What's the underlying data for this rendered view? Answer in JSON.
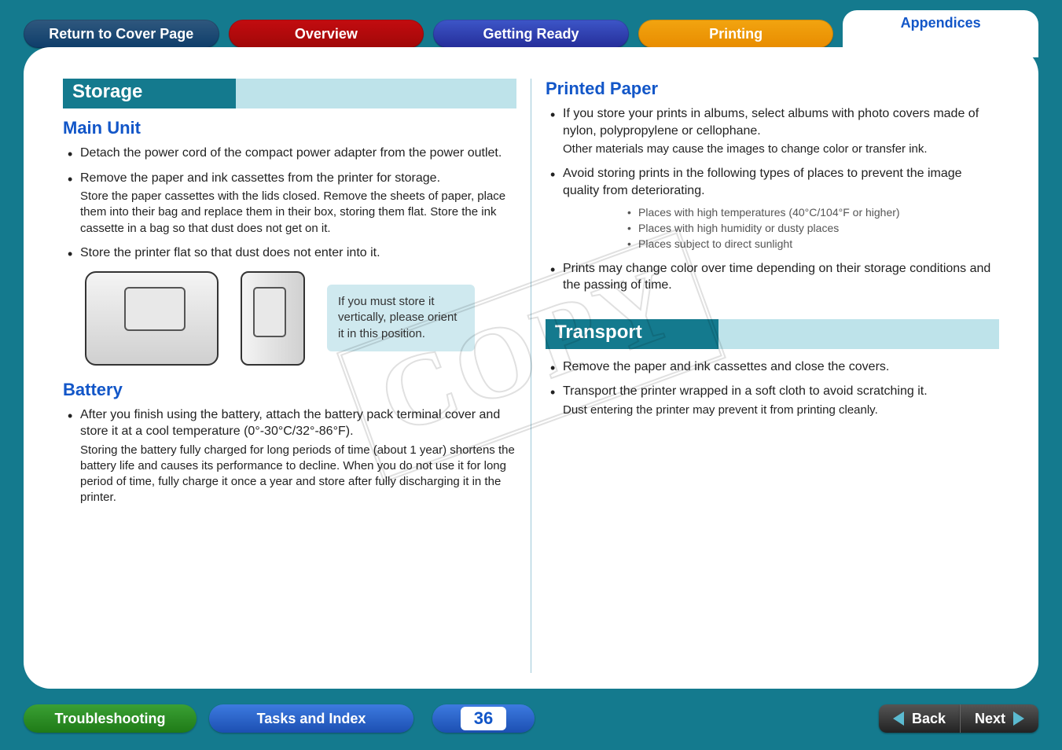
{
  "nav": {
    "cover": "Return to Cover Page",
    "overview": "Overview",
    "getting": "Getting Ready",
    "printing": "Printing",
    "appendices": "Appendices"
  },
  "watermark": "COPY",
  "left": {
    "section_title": "Storage",
    "main_unit": {
      "heading": "Main Unit",
      "b1": "Detach the power cord of the compact power adapter from the power outlet.",
      "b2_main": "Remove the paper and ink cassettes from the printer for storage.",
      "b2_sub": "Store the paper cassettes with the lids closed. Remove the sheets of paper, place them into their bag and replace them in their box, storing them flat. Store the ink cassette in a bag so that dust does not get on it.",
      "b3": "Store the printer flat so that dust does not enter into it.",
      "callout": "If you must store it vertically, please orient it in this position."
    },
    "battery": {
      "heading": "Battery",
      "b1_main": "After you finish using the battery, attach the battery pack terminal cover and store it at a cool temperature (0°-30°C/32°-86°F).",
      "b1_sub": "Storing the battery fully charged for long periods of time (about 1 year) shortens the battery life and causes its performance to decline. When you do not use it for long period of time, fully charge it once a year and store after fully discharging it in the printer."
    }
  },
  "right": {
    "printed_paper": {
      "heading": "Printed Paper",
      "b1_main": "If you store your prints in albums, select albums with photo covers made of nylon, polypropylene or cellophane.",
      "b1_sub": "Other materials may cause the images to change color or transfer ink.",
      "b2": "Avoid storing prints in the following types of places to prevent the image quality from deteriorating.",
      "b2_s1": "Places with high temperatures (40°C/104°F or higher)",
      "b2_s2": "Places with high humidity or dusty places",
      "b2_s3": "Places subject to direct sunlight",
      "b3": "Prints may change color over time depending on their storage conditions and the passing of time."
    },
    "transport": {
      "section_title": "Transport",
      "b1": "Remove the paper and ink cassettes and close the covers.",
      "b2_main": "Transport the printer wrapped in a soft cloth to avoid scratching it.",
      "b2_sub": "Dust entering the printer may prevent it from printing cleanly."
    }
  },
  "footer": {
    "troubleshooting": "Troubleshooting",
    "tasks": "Tasks and Index",
    "page": "36",
    "back": "Back",
    "next": "Next"
  }
}
